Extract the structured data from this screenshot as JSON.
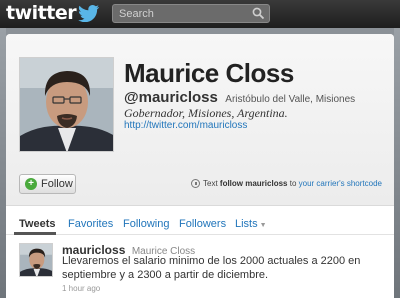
{
  "header": {
    "logo_text": "twitter",
    "search": {
      "placeholder": "Search",
      "value": ""
    }
  },
  "profile": {
    "display_name": "Maurice Closs",
    "handle": "@mauricloss",
    "location": "Aristóbulo del Valle, Misiones",
    "bio": "Gobernador, Misiones, Argentina.",
    "url": "http://twitter.com/mauricloss",
    "follow_label": "Follow",
    "sms": {
      "prefix": "Text",
      "command": "follow mauricloss",
      "middle": "to",
      "link": "your carrier's shortcode"
    }
  },
  "tabs": [
    {
      "label": "Tweets",
      "active": true
    },
    {
      "label": "Favorites"
    },
    {
      "label": "Following"
    },
    {
      "label": "Followers"
    },
    {
      "label": "Lists"
    }
  ],
  "tweet": {
    "handle": "mauricloss",
    "name": "Maurice Closs",
    "text": "Llevaremos el salario minimo de los 2000 actuales a 2200 en septiembre y a 2300 a partir de diciembre.",
    "time": "1 hour ago"
  },
  "colors": {
    "link": "#2276bb",
    "topbar": "#2a2a2a",
    "follow_plus": "#4aaa3c"
  },
  "icons": [
    "twitter-bird-icon",
    "search-icon",
    "plus-icon",
    "sms-icon",
    "chevron-down-icon"
  ]
}
